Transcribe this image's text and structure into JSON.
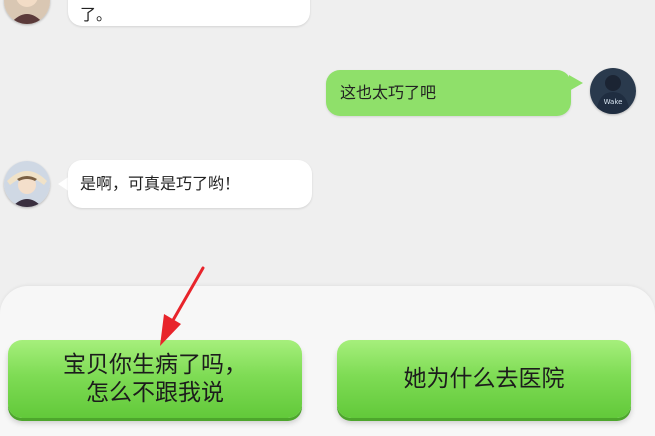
{
  "messages": [
    {
      "side": "left",
      "text": "了。"
    },
    {
      "side": "right",
      "text": "这也太巧了吧"
    },
    {
      "side": "left",
      "text": "是啊，可真是巧了哟！"
    }
  ],
  "choices": [
    {
      "label": "宝贝你生病了吗，\n 怎么不跟我说"
    },
    {
      "label": "她为什么去医院"
    }
  ],
  "colors": {
    "background": "#efefef",
    "incoming_bubble": "#ffffff",
    "outgoing_bubble": "#8fe06a",
    "choice_button": "#7fdc55",
    "annotation_arrow": "#e8242b"
  },
  "avatar_text": "Wake",
  "icons": [
    "female-avatar-icon",
    "male-avatar-icon",
    "annotation-arrow-icon"
  ]
}
